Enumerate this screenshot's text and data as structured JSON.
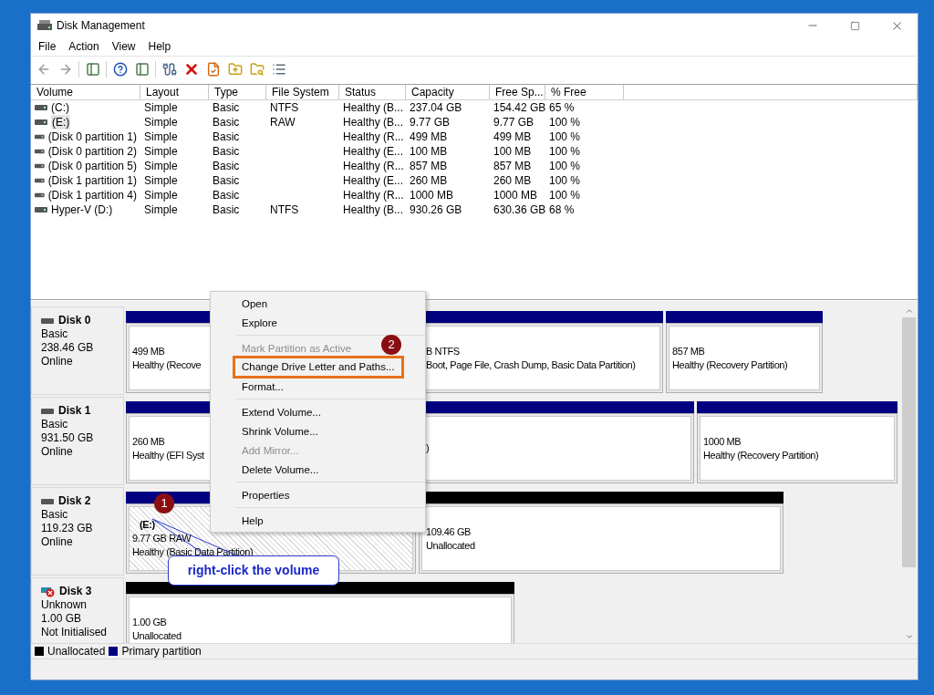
{
  "window": {
    "title": "Disk Management"
  },
  "menu_bar": [
    "File",
    "Action",
    "View",
    "Help"
  ],
  "toolbar": [
    {
      "kind": "back",
      "disabled": true
    },
    {
      "kind": "forward",
      "disabled": true
    },
    {
      "kind": "panel",
      "disabled": false
    },
    {
      "kind": "help",
      "disabled": false
    },
    {
      "kind": "panel",
      "disabled": false
    },
    {
      "kind": "connect",
      "disabled": false
    },
    {
      "kind": "delete",
      "disabled": false
    },
    {
      "kind": "properties",
      "disabled": false
    },
    {
      "kind": "folder-up",
      "disabled": false
    },
    {
      "kind": "folder-search",
      "disabled": false
    },
    {
      "kind": "list",
      "disabled": false
    }
  ],
  "volume_table": {
    "columns": [
      "Volume",
      "Layout",
      "Type",
      "File System",
      "Status",
      "Capacity",
      "Free Sp...",
      "% Free"
    ],
    "rows": [
      {
        "selected": false,
        "cells": [
          "(C:)",
          "Simple",
          "Basic",
          "NTFS",
          "Healthy (B...",
          "237.04 GB",
          "154.42 GB",
          "65 %"
        ]
      },
      {
        "selected": true,
        "cells": [
          "(E:)",
          "Simple",
          "Basic",
          "RAW",
          "Healthy (B...",
          "9.77 GB",
          "9.77 GB",
          "100 %"
        ]
      },
      {
        "selected": false,
        "cells": [
          "(Disk 0 partition 1)",
          "Simple",
          "Basic",
          "",
          "Healthy (R...",
          "499 MB",
          "499 MB",
          "100 %"
        ]
      },
      {
        "selected": false,
        "cells": [
          "(Disk 0 partition 2)",
          "Simple",
          "Basic",
          "",
          "Healthy (E...",
          "100 MB",
          "100 MB",
          "100 %"
        ]
      },
      {
        "selected": false,
        "cells": [
          "(Disk 0 partition 5)",
          "Simple",
          "Basic",
          "",
          "Healthy (R...",
          "857 MB",
          "857 MB",
          "100 %"
        ]
      },
      {
        "selected": false,
        "cells": [
          "(Disk 1 partition 1)",
          "Simple",
          "Basic",
          "",
          "Healthy (E...",
          "260 MB",
          "260 MB",
          "100 %"
        ]
      },
      {
        "selected": false,
        "cells": [
          "(Disk 1 partition 4)",
          "Simple",
          "Basic",
          "",
          "Healthy (R...",
          "1000 MB",
          "1000 MB",
          "100 %"
        ]
      },
      {
        "selected": false,
        "cells": [
          "Hyper-V (D:)",
          "Simple",
          "Basic",
          "NTFS",
          "Healthy (B...",
          "930.26 GB",
          "630.36 GB",
          "68 %"
        ]
      }
    ]
  },
  "disks": [
    {
      "name": "Disk 0",
      "kind": "normal",
      "lines": [
        "Basic",
        "238.46 GB",
        "Online"
      ],
      "partitions": [
        {
          "kind": "primary",
          "selected": false,
          "lines": [
            "499 MB",
            "Healthy (Recove"
          ]
        },
        {
          "kind": "primary",
          "selected": false,
          "lines": [
            "B NTFS",
            "Boot, Page File, Crash Dump, Basic Data Partition)"
          ]
        },
        {
          "kind": "primary",
          "selected": false,
          "lines": [
            "857 MB",
            "Healthy (Recovery Partition)"
          ]
        }
      ]
    },
    {
      "name": "Disk 1",
      "kind": "normal",
      "lines": [
        "Basic",
        "931.50 GB",
        "Online"
      ],
      "partitions": [
        {
          "kind": "primary",
          "selected": false,
          "lines": [
            "260 MB",
            "Healthy (EFI Syst"
          ]
        },
        {
          "kind": "primary",
          "selected": false,
          "lines": [
            ")"
          ]
        },
        {
          "kind": "primary",
          "selected": false,
          "lines": [
            "1000 MB",
            "Healthy (Recovery Partition)"
          ]
        }
      ]
    },
    {
      "name": "Disk 2",
      "kind": "normal",
      "lines": [
        "Basic",
        "119.23 GB",
        "Online"
      ],
      "partitions": [
        {
          "kind": "primary",
          "selected": true,
          "title": "(E:)",
          "lines": [
            "9.77 GB RAW",
            "Healthy (Basic Data Partition)"
          ]
        },
        {
          "kind": "unallocated",
          "selected": false,
          "lines": [
            "109.46 GB",
            "Unallocated"
          ]
        }
      ]
    },
    {
      "name": "Disk 3",
      "kind": "error",
      "lines": [
        "Unknown",
        "1.00 GB",
        "Not Initialised"
      ],
      "partitions": [
        {
          "kind": "unallocated",
          "selected": false,
          "lines": [
            "1.00 GB",
            "Unallocated"
          ]
        }
      ]
    }
  ],
  "legend": [
    {
      "label": "Unallocated",
      "color": "#000000"
    },
    {
      "label": "Primary partition",
      "color": "#000080"
    }
  ],
  "context_menu": [
    {
      "kind": "item",
      "label": "Open",
      "disabled": false,
      "outlined": false
    },
    {
      "kind": "item",
      "label": "Explore",
      "disabled": false,
      "outlined": false
    },
    {
      "kind": "separator"
    },
    {
      "kind": "item",
      "label": "Mark Partition as Active",
      "disabled": true,
      "outlined": false
    },
    {
      "kind": "item",
      "label": "Change Drive Letter and Paths...",
      "disabled": false,
      "outlined": true
    },
    {
      "kind": "item",
      "label": "Format...",
      "disabled": false,
      "outlined": false
    },
    {
      "kind": "separator"
    },
    {
      "kind": "item",
      "label": "Extend Volume...",
      "disabled": false,
      "outlined": false
    },
    {
      "kind": "item",
      "label": "Shrink Volume...",
      "disabled": false,
      "outlined": false
    },
    {
      "kind": "item",
      "label": "Add Mirror...",
      "disabled": true,
      "outlined": false
    },
    {
      "kind": "item",
      "label": "Delete Volume...",
      "disabled": false,
      "outlined": false
    },
    {
      "kind": "separator"
    },
    {
      "kind": "item",
      "label": "Properties",
      "disabled": false,
      "outlined": false
    },
    {
      "kind": "separator"
    },
    {
      "kind": "item",
      "label": "Help",
      "disabled": false,
      "outlined": false
    }
  ],
  "annotations": {
    "steps": [
      "1",
      "2"
    ],
    "callout": "right-click the volume"
  }
}
